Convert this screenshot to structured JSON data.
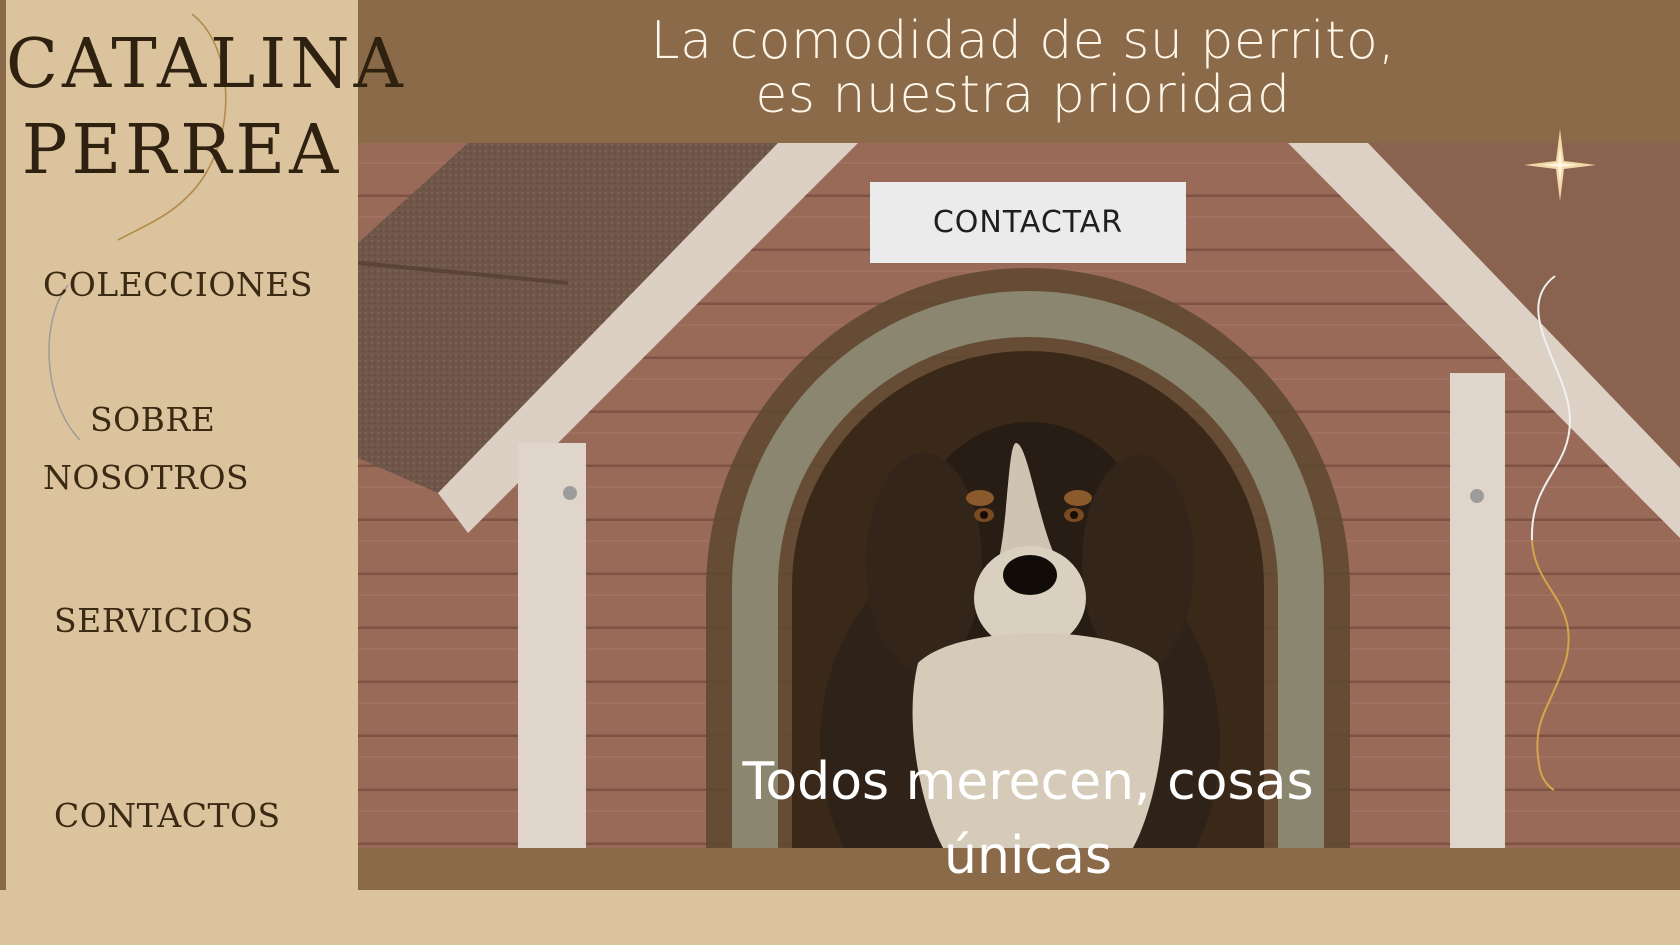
{
  "brand": {
    "line1": "CATALINA",
    "line2": "PERREA"
  },
  "nav": {
    "colecciones": "COLECCIONES",
    "sobre_line1": "SOBRE",
    "sobre_line2": "NOSOTROS",
    "servicios": "SERVICIOS",
    "contactos": "CONTACTOS"
  },
  "hero": {
    "headline_line1": "La comodidad de su perrito,",
    "headline_line2": "es nuestra prioridad",
    "cta_label": "CONTACTAR",
    "tagline_line1": "Todos merecen, cosas",
    "tagline_line2": "únicas"
  },
  "colors": {
    "main_brown": "#8a6a48",
    "sidebar_beige": "#dbc39d",
    "button_bg": "#ebebeb",
    "text_dark": "#2e2110"
  },
  "icons": {
    "sparkle": "sparkle-icon"
  }
}
